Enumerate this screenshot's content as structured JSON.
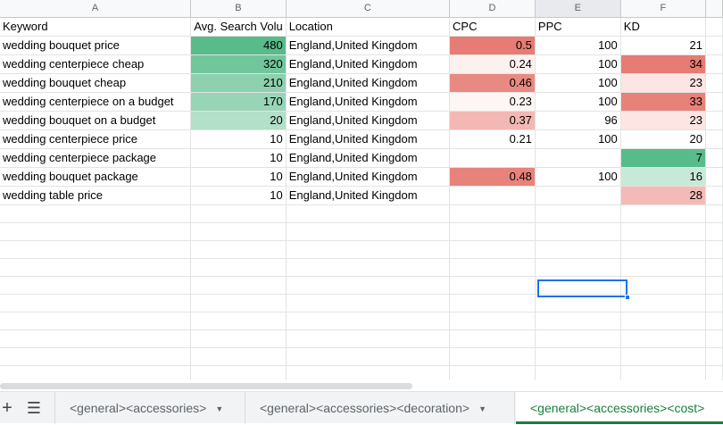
{
  "columns": [
    "A",
    "B",
    "C",
    "D",
    "E",
    "F"
  ],
  "selected_column": "E",
  "header_row": [
    "Keyword",
    "Avg. Search Volu",
    "Location",
    "CPC",
    "PPC",
    "KD"
  ],
  "rows": [
    {
      "keyword": "wedding bouquet price",
      "volume": "480",
      "location": "England,United Kingdom",
      "cpc": "0.5",
      "ppc": "100",
      "kd": "21"
    },
    {
      "keyword": "wedding centerpiece cheap",
      "volume": "320",
      "location": "England,United Kingdom",
      "cpc": "0.24",
      "ppc": "100",
      "kd": "34"
    },
    {
      "keyword": "wedding bouquet cheap",
      "volume": "210",
      "location": "England,United Kingdom",
      "cpc": "0.46",
      "ppc": "100",
      "kd": "23"
    },
    {
      "keyword": "wedding centerpiece on a budget",
      "volume": "170",
      "location": "England,United Kingdom",
      "cpc": "0.23",
      "ppc": "100",
      "kd": "33"
    },
    {
      "keyword": "wedding bouquet on a budget",
      "volume": "20",
      "location": "England,United Kingdom",
      "cpc": "0.37",
      "ppc": "96",
      "kd": "23"
    },
    {
      "keyword": "wedding centerpiece price",
      "volume": "10",
      "location": "England,United Kingdom",
      "cpc": "0.21",
      "ppc": "100",
      "kd": "20"
    },
    {
      "keyword": "wedding centerpiece package",
      "volume": "10",
      "location": "England,United Kingdom",
      "cpc": "",
      "ppc": "",
      "kd": "7"
    },
    {
      "keyword": "wedding bouquet package",
      "volume": "10",
      "location": "England,United Kingdom",
      "cpc": "0.48",
      "ppc": "100",
      "kd": "16"
    },
    {
      "keyword": "wedding table price",
      "volume": "10",
      "location": "England,United Kingdom",
      "cpc": "",
      "ppc": "",
      "kd": "28"
    }
  ],
  "cell_colors": {
    "volume": [
      "#57bb8a",
      "#72c69c",
      "#8dd1ae",
      "#98d5b6",
      "#b2e0c8",
      "",
      "",
      "",
      ""
    ],
    "cpc": [
      "#e67c73",
      "#fdf1f0",
      "#e98a82",
      "#fef6f5",
      "#f3b8b3",
      "",
      "",
      "#e8837b",
      ""
    ],
    "kd": [
      "",
      "#e67c73",
      "#fce5e3",
      "#e88178",
      "#fce5e3",
      "",
      "#57bb8a",
      "#c8e9d8",
      "#f4bbb6"
    ]
  },
  "tabs": {
    "add_icon": "plus-icon",
    "all_sheets_icon": "menu-icon",
    "items": [
      {
        "label": "<general><accessories>"
      },
      {
        "label": "<general><accessories><decoration>"
      },
      {
        "label": "<general><accessories><cost>"
      }
    ],
    "active_index": 2,
    "active_color": "#188038"
  },
  "selection_color": "#1a73e8"
}
